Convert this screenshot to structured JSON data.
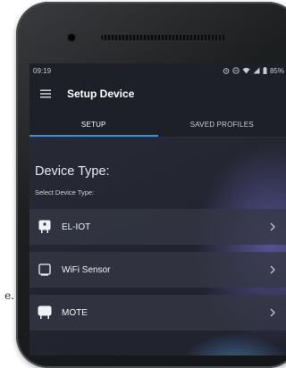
{
  "side_text": "e.",
  "status_bar": {
    "time": "09:19",
    "battery": "85%"
  },
  "app_bar": {
    "title": "Setup Device"
  },
  "tabs": [
    {
      "label": "SETUP",
      "active": true
    },
    {
      "label": "SAVED PROFILES",
      "active": false
    }
  ],
  "section": {
    "title": "Device Type:",
    "subtitle": "Select Device Type:"
  },
  "devices": [
    {
      "label": "EL-IOT",
      "icon": "device-icon"
    },
    {
      "label": "WiFi Sensor",
      "icon": "tablet-icon"
    },
    {
      "label": "MOTE",
      "icon": "device-icon"
    }
  ],
  "colors": {
    "screen_bg": "#1e2029",
    "accent": "#3f8fd8",
    "row_bg": "#343744"
  }
}
